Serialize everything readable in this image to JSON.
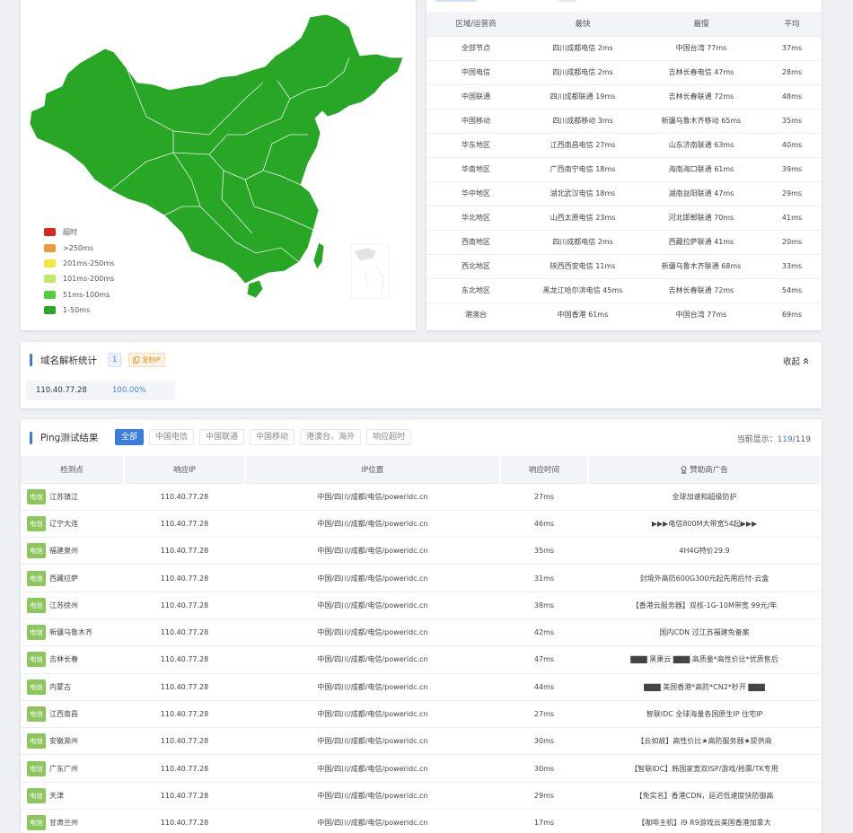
{
  "map": {
    "legend": [
      {
        "label": "超时",
        "color": "#d9281e"
      },
      {
        "label": ">250ms",
        "color": "#ee9a3a"
      },
      {
        "label": "201ms-250ms",
        "color": "#f0ea3c"
      },
      {
        "label": "101ms-200ms",
        "color": "#bfea64"
      },
      {
        "label": "51ms-100ms",
        "color": "#4fcf3c"
      },
      {
        "label": "1-50ms",
        "color": "#28a625"
      }
    ],
    "fill_color": "#28a625"
  },
  "region_stats": {
    "headers": [
      "区域/运营商",
      "最快",
      "最慢",
      "平均"
    ],
    "rows": [
      [
        "全部节点",
        "四川成都电信 2ms",
        "中国台湾 77ms",
        "37ms"
      ],
      [
        "中国电信",
        "四川成都电信 2ms",
        "吉林长春电信 47ms",
        "28ms"
      ],
      [
        "中国联通",
        "四川成都联通 19ms",
        "吉林长春联通 72ms",
        "48ms"
      ],
      [
        "中国移动",
        "四川成都移动 3ms",
        "新疆乌鲁木齐移动 65ms",
        "35ms"
      ],
      [
        "华东地区",
        "江西南昌电信 27ms",
        "山东济南联通 63ms",
        "40ms"
      ],
      [
        "华南地区",
        "广西南宁电信 18ms",
        "海南海口联通 61ms",
        "39ms"
      ],
      [
        "华中地区",
        "湖北武汉电信 18ms",
        "湖南益阳联通 47ms",
        "29ms"
      ],
      [
        "华北地区",
        "山西太原电信 23ms",
        "河北邯郸联通 70ms",
        "41ms"
      ],
      [
        "西南地区",
        "四川成都电信 2ms",
        "西藏拉萨联通 41ms",
        "20ms"
      ],
      [
        "西北地区",
        "陕西西安电信 11ms",
        "新疆乌鲁木齐联通 68ms",
        "33ms"
      ],
      [
        "东北地区",
        "黑龙江哈尔滨电信 45ms",
        "吉林长春联通 72ms",
        "54ms"
      ],
      [
        "港澳台",
        "中国香港 61ms",
        "中国台湾 77ms",
        "69ms"
      ]
    ]
  },
  "dns": {
    "title": "域名解析统计",
    "count": "1",
    "copy_label": "复制IP",
    "collapse_label": "收起",
    "records": [
      {
        "ip": "110.40.77.28",
        "percent": "100.00%"
      }
    ]
  },
  "ping": {
    "title": "Ping测试结果",
    "filters": [
      "全部",
      "中国电信",
      "中国联通",
      "中国移动",
      "港澳台、海外",
      "响应超时"
    ],
    "display_label": "当前显示：",
    "display_current": "119",
    "display_total": "119",
    "headers": [
      "检测点",
      "响应IP",
      "IP位置",
      "响应时间",
      "赞助商广告"
    ],
    "rows": [
      {
        "isp": "电信",
        "node": "江苏镇江",
        "ip": "110.40.77.28",
        "location": "中国/四川/成都/电信/poweridc.cn",
        "time": "27ms",
        "ad": "全球加速和超级防护"
      },
      {
        "isp": "电信",
        "node": "辽宁大连",
        "ip": "110.40.77.28",
        "location": "中国/四川/成都/电信/poweridc.cn",
        "time": "46ms",
        "ad": "▶▶▶电信800M大带宽54起▶▶▶"
      },
      {
        "isp": "电信",
        "node": "福建泉州",
        "ip": "110.40.77.28",
        "location": "中国/四川/成都/电信/poweridc.cn",
        "time": "35ms",
        "ad": "4H4G特价29.9"
      },
      {
        "isp": "电信",
        "node": "西藏拉萨",
        "ip": "110.40.77.28",
        "location": "中国/四川/成都/电信/poweridc.cn",
        "time": "31ms",
        "ad": "封境外高防600G300元起先用后付-云盒"
      },
      {
        "isp": "电信",
        "node": "江苏徐州",
        "ip": "110.40.77.28",
        "location": "中国/四川/成都/电信/poweridc.cn",
        "time": "38ms",
        "ad": "【香港云服务器】双核-1G-10M带宽 99元/年"
      },
      {
        "isp": "电信",
        "node": "新疆乌鲁木齐",
        "ip": "110.40.77.28",
        "location": "中国/四川/成都/电信/poweridc.cn",
        "time": "42ms",
        "ad": "国内CDN 过江苏福建免备案"
      },
      {
        "isp": "电信",
        "node": "吉林长春",
        "ip": "110.40.77.28",
        "location": "中国/四川/成都/电信/poweridc.cn",
        "time": "47ms",
        "ad": "▇▇▇ 黑果云 ▇▇▇ 高质量*高性价比*优质售后"
      },
      {
        "isp": "电信",
        "node": "内蒙古",
        "ip": "110.40.77.28",
        "location": "中国/四川/成都/电信/poweridc.cn",
        "time": "44ms",
        "ad": "▇▇▇ 美国香港*高防*CN2*秒开 ▇▇▇"
      },
      {
        "isp": "电信",
        "node": "江西南昌",
        "ip": "110.40.77.28",
        "location": "中国/四川/成都/电信/poweridc.cn",
        "time": "27ms",
        "ad": "智联IDC 全球海量各国原生IP 住宅IP"
      },
      {
        "isp": "电信",
        "node": "安徽滁州",
        "ip": "110.40.77.28",
        "location": "中国/四川/成都/电信/poweridc.cn",
        "time": "30ms",
        "ad": "【云如故】高性价比★高防服务器★提供商"
      },
      {
        "isp": "电信",
        "node": "广东广州",
        "ip": "110.40.77.28",
        "location": "中国/四川/成都/电信/poweridc.cn",
        "time": "30ms",
        "ad": "【智联IDC】韩国家宽双ISP/游戏/抢票/TK专用"
      },
      {
        "isp": "电信",
        "node": "天津",
        "ip": "110.40.77.28",
        "location": "中国/四川/成都/电信/poweridc.cn",
        "time": "29ms",
        "ad": "【免实名】香港CDN，延迟低速度快防御高"
      },
      {
        "isp": "电信",
        "node": "甘肃兰州",
        "ip": "110.40.77.28",
        "location": "中国/四川/成都/电信/poweridc.cn",
        "time": "17ms",
        "ad": "【咖啡主机】I9 R9游戏云美国香港加拿大"
      }
    ]
  }
}
